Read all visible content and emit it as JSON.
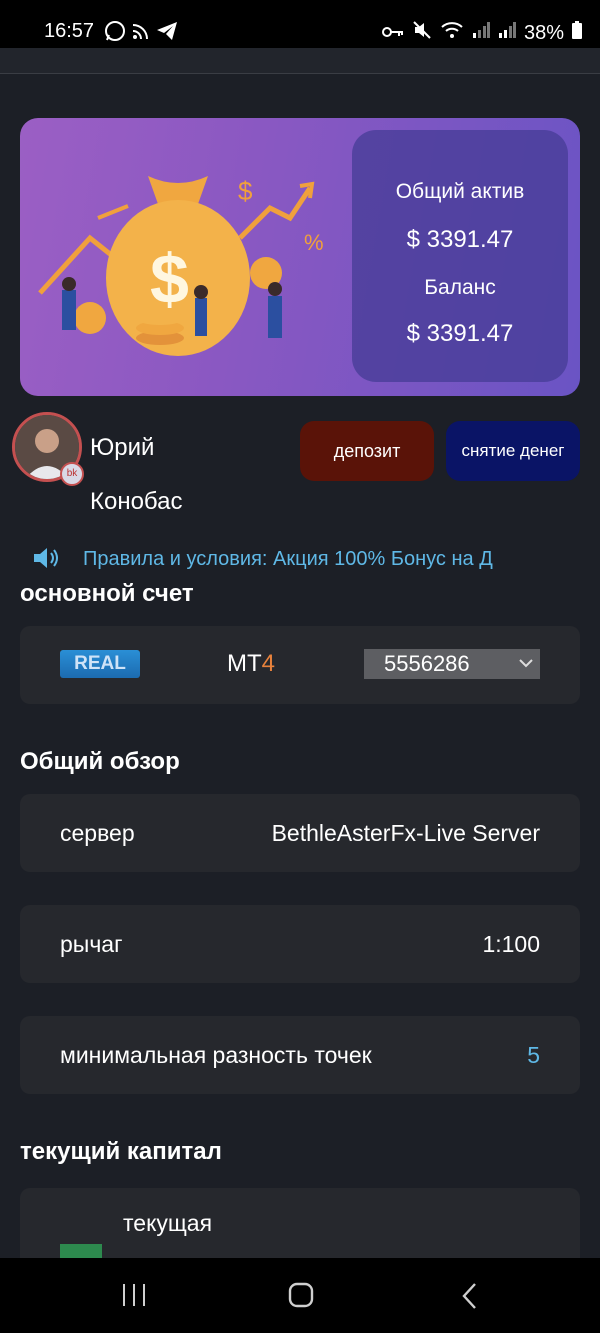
{
  "status_bar": {
    "time": "16:57",
    "battery": "38%",
    "left_icons": [
      "whatsapp-icon",
      "cast-icon",
      "telegram-icon"
    ],
    "right_icons": [
      "key-icon",
      "mute-icon",
      "wifi-icon",
      "signal-icon",
      "signal-icon",
      "battery-icon"
    ]
  },
  "hero": {
    "total_assets_label": "Общий актив",
    "total_assets_value": "$ 3391.47",
    "balance_label": "Баланс",
    "balance_value": "$ 3391.47"
  },
  "user": {
    "first_name": "Юрий",
    "last_name": "Конобас"
  },
  "actions": {
    "deposit_label": "депозит",
    "withdraw_label": "снятие денег",
    "deposit_color": "#5a1308",
    "withdraw_color": "#0a1466"
  },
  "notice": {
    "text": "Правила и условия: Акция 100% Бонус на Д"
  },
  "main_account": {
    "title": "основной счет",
    "badge": "REAL",
    "platform_prefix": "MT",
    "platform_suffix": "4",
    "account_number": "5556286"
  },
  "overview": {
    "title": "Общий обзор",
    "rows": [
      {
        "label": "сервер",
        "value": "BethleAsterFx-Live Server"
      },
      {
        "label": "рычаг",
        "value": "1:100"
      },
      {
        "label": "минимальная разность точек",
        "value": "5"
      }
    ]
  },
  "capital": {
    "title": "текущий капитал",
    "first_item_label": "текущая"
  },
  "colors": {
    "background": "#1c1f26",
    "card": "#26282d",
    "accent_blue": "#5fb8e6",
    "mt4_orange": "#e8823c"
  }
}
